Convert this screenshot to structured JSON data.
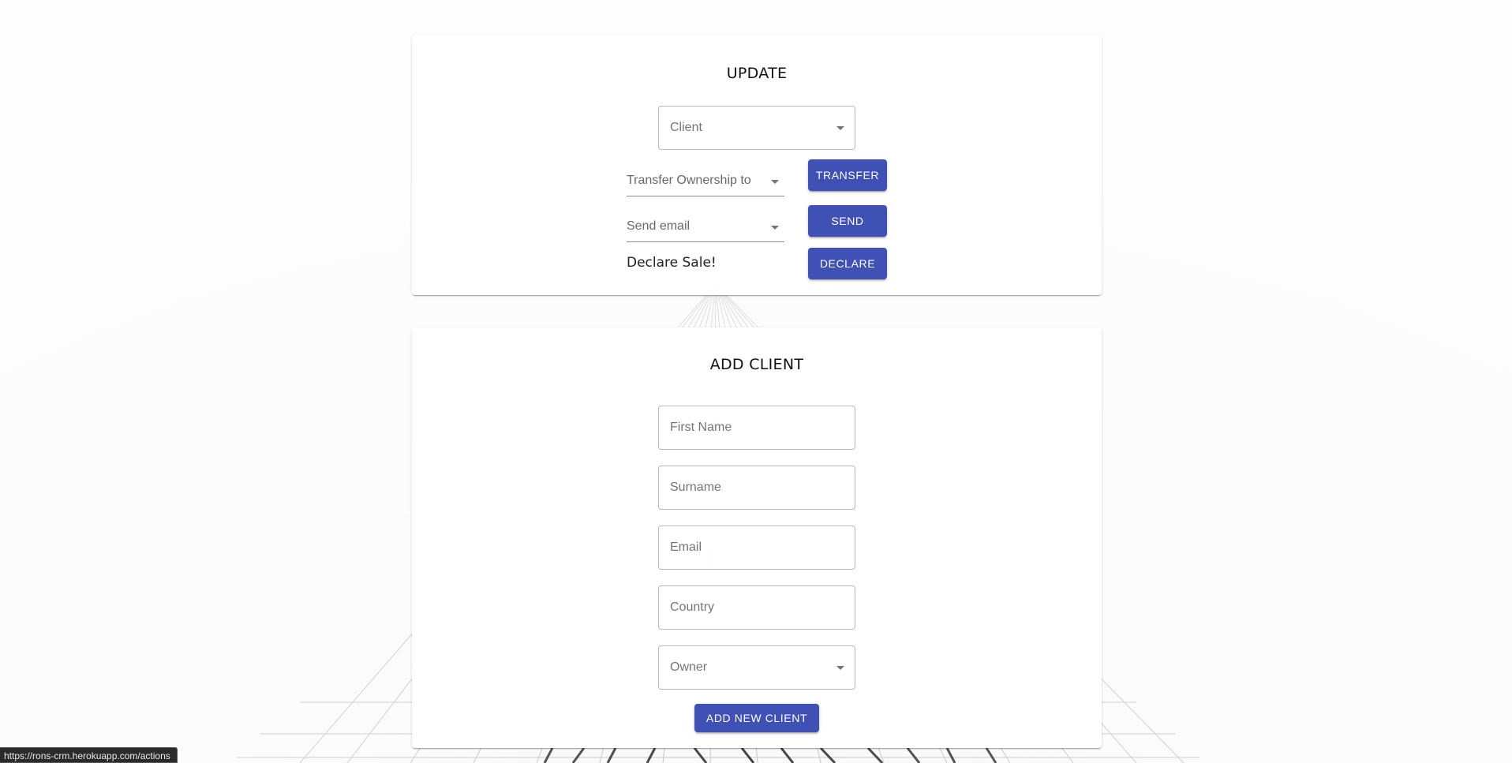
{
  "update": {
    "title": "UPDATE",
    "client_label": "Client",
    "transfer_label": "Transfer Ownership to",
    "send_email_label": "Send email",
    "declare_text": "Declare Sale!",
    "transfer_button": "TRANSFER",
    "send_button": "SEND",
    "declare_button": "DECLARE"
  },
  "add_client": {
    "title": "ADD CLIENT",
    "first_name_placeholder": "First Name",
    "surname_placeholder": "Surname",
    "email_placeholder": "Email",
    "country_placeholder": "Country",
    "owner_label": "Owner",
    "submit_button": "ADD NEW CLIENT"
  },
  "status_bar": {
    "url": "https://rons-crm.herokuapp.com/actions"
  },
  "colors": {
    "primary_button": "#3f51b5",
    "background": "#ffffff"
  },
  "icons": {
    "dropdown": "caret-down-icon"
  }
}
